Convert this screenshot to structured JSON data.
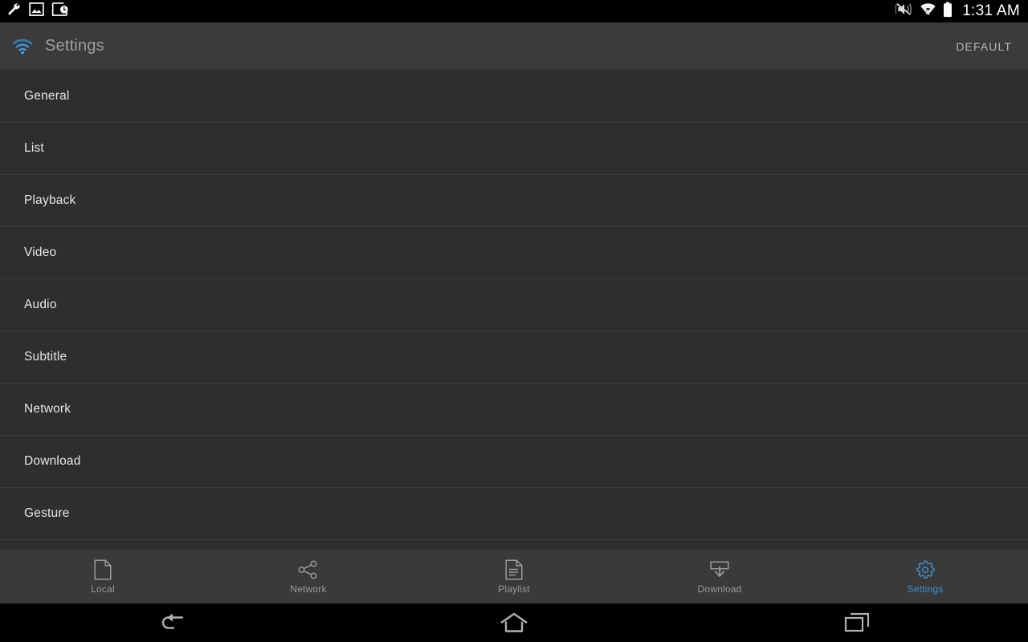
{
  "status_bar": {
    "left_icons": [
      "wrench-icon",
      "image-icon",
      "screenshot-clock-icon"
    ],
    "right_icons": [
      "mute-vibrate-icon",
      "wifi-activity-icon",
      "battery-full-icon"
    ],
    "time": "1:31 AM"
  },
  "app_bar": {
    "icon": "wifi-icon",
    "title": "Settings",
    "action_label": "DEFAULT"
  },
  "settings_list": {
    "items": [
      {
        "label": "General"
      },
      {
        "label": "List"
      },
      {
        "label": "Playback"
      },
      {
        "label": "Video"
      },
      {
        "label": "Audio"
      },
      {
        "label": "Subtitle"
      },
      {
        "label": "Network"
      },
      {
        "label": "Download"
      },
      {
        "label": "Gesture"
      }
    ]
  },
  "tab_bar": {
    "active_color": "#3d90cf",
    "inactive_color": "#9a9a9a",
    "tabs": [
      {
        "label": "Local",
        "icon": "document-icon",
        "active": false
      },
      {
        "label": "Network",
        "icon": "share-nodes-icon",
        "active": false
      },
      {
        "label": "Playlist",
        "icon": "playlist-doc-icon",
        "active": false
      },
      {
        "label": "Download",
        "icon": "download-tray-icon",
        "active": false
      },
      {
        "label": "Settings",
        "icon": "gear-icon",
        "active": true
      }
    ]
  },
  "nav_bar": {
    "buttons": [
      "back-icon",
      "home-icon",
      "recents-icon"
    ]
  }
}
